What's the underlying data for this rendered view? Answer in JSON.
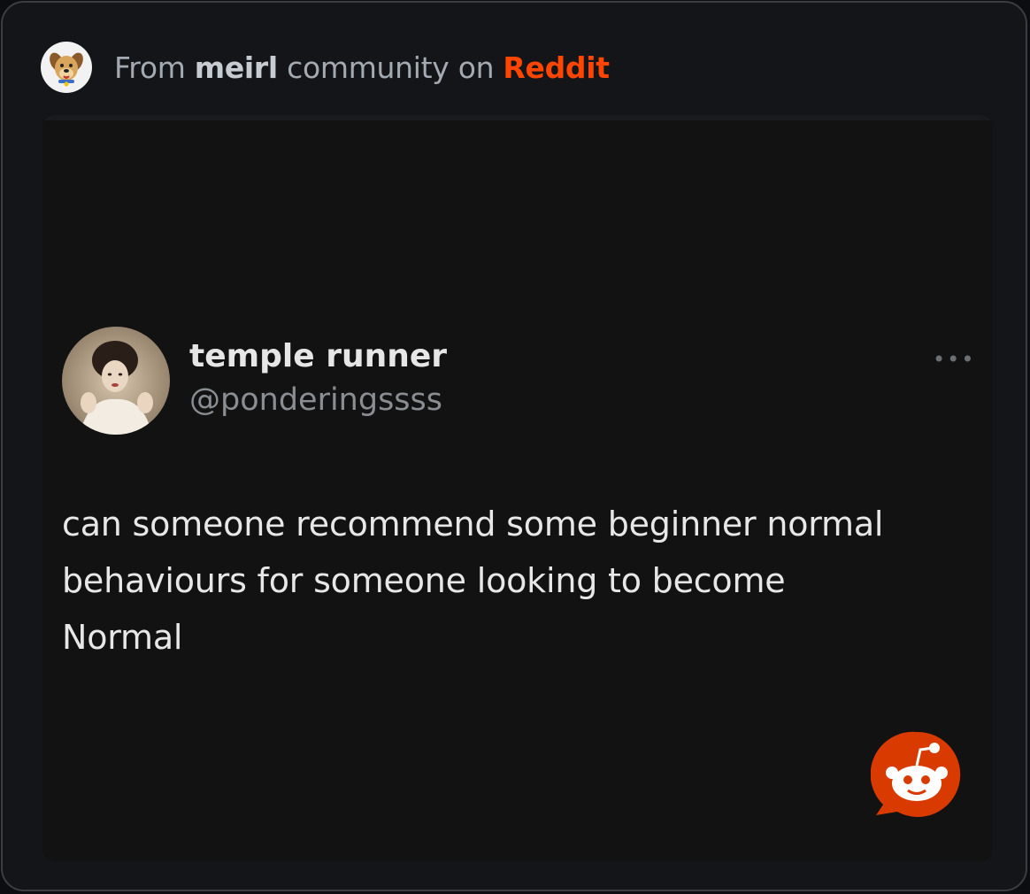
{
  "header": {
    "prefix": "From ",
    "community": "meirl",
    "middle": " community on ",
    "site": "Reddit",
    "icon": "dog-mascot-avatar-icon"
  },
  "tweet": {
    "display_name": "temple runner",
    "handle": "@ponderingssss",
    "more_label": "•••",
    "text": "can someone recommend some beginner normal\nbehaviours for someone looking to become\nNormal"
  },
  "badge": {
    "icon": "reddit-snoo-icon"
  },
  "colors": {
    "reddit_orange": "#ff4500",
    "card_bg": "#131518",
    "media_bg": "#121212",
    "border": "#3a3d42"
  }
}
